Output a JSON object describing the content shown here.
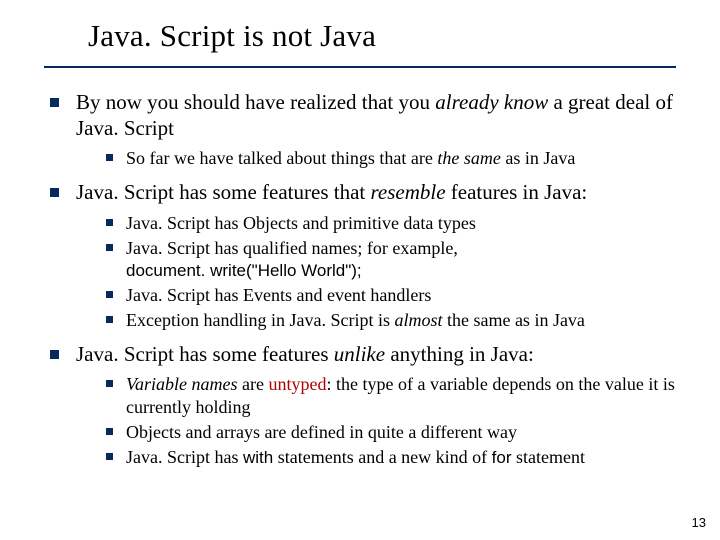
{
  "title": "Java. Script is not Java",
  "page_number": "13",
  "b1": {
    "pre": "By now you should have realized that you ",
    "em": "already know",
    "post": " a great deal of Java. Script",
    "sub1": {
      "pre": "So far we have talked about things that are ",
      "em": "the same",
      "post": " as in Java"
    }
  },
  "b2": {
    "pre": "Java. Script has some features that ",
    "em": "resemble",
    "post": " features in Java:",
    "sub1": "Java. Script has Objects and primitive data types",
    "sub2": {
      "text": "Java. Script has qualified names; for example,",
      "code": "document. write(\"Hello World\");"
    },
    "sub3": "Java. Script has Events and event handlers",
    "sub4": {
      "pre": "Exception handling in Java. Script is ",
      "em": "almost",
      "post": " the same as in Java"
    }
  },
  "b3": {
    "pre": "Java. Script has some features ",
    "em": "unlike",
    "post": " anything in Java:",
    "sub1": {
      "em": "Variable names",
      "mid": " are ",
      "red": "untyped",
      "post": ": the type of a variable depends on the value it is currently holding"
    },
    "sub2": "Objects and arrays are defined in quite a different way",
    "sub3": {
      "pre": "Java. Script has ",
      "code1": "with",
      "mid": " statements and a new kind of ",
      "code2": "for",
      "post": " statement"
    }
  }
}
